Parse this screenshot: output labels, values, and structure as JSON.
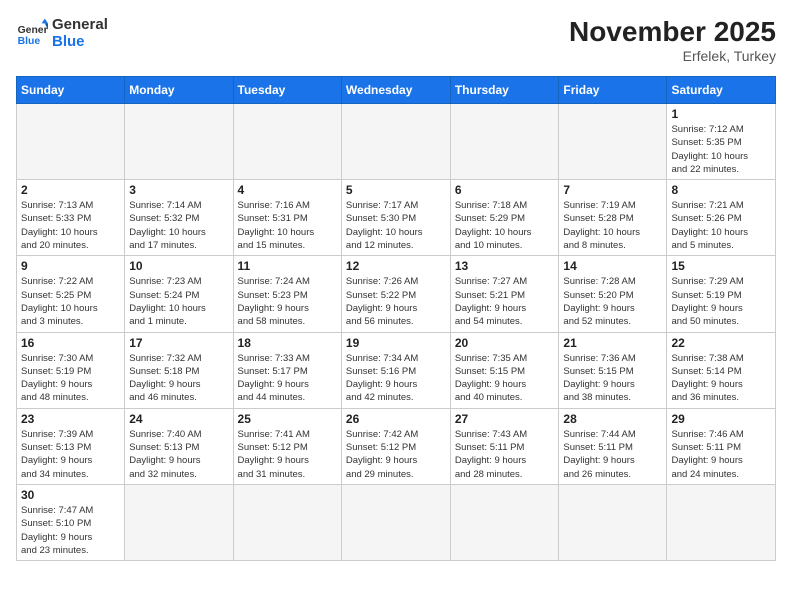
{
  "header": {
    "logo_general": "General",
    "logo_blue": "Blue",
    "month": "November 2025",
    "location": "Erfelek, Turkey"
  },
  "days_of_week": [
    "Sunday",
    "Monday",
    "Tuesday",
    "Wednesday",
    "Thursday",
    "Friday",
    "Saturday"
  ],
  "weeks": [
    [
      {
        "day": "",
        "content": ""
      },
      {
        "day": "",
        "content": ""
      },
      {
        "day": "",
        "content": ""
      },
      {
        "day": "",
        "content": ""
      },
      {
        "day": "",
        "content": ""
      },
      {
        "day": "",
        "content": ""
      },
      {
        "day": "1",
        "content": "Sunrise: 7:12 AM\nSunset: 5:35 PM\nDaylight: 10 hours\nand 22 minutes."
      }
    ],
    [
      {
        "day": "2",
        "content": "Sunrise: 7:13 AM\nSunset: 5:33 PM\nDaylight: 10 hours\nand 20 minutes."
      },
      {
        "day": "3",
        "content": "Sunrise: 7:14 AM\nSunset: 5:32 PM\nDaylight: 10 hours\nand 17 minutes."
      },
      {
        "day": "4",
        "content": "Sunrise: 7:16 AM\nSunset: 5:31 PM\nDaylight: 10 hours\nand 15 minutes."
      },
      {
        "day": "5",
        "content": "Sunrise: 7:17 AM\nSunset: 5:30 PM\nDaylight: 10 hours\nand 12 minutes."
      },
      {
        "day": "6",
        "content": "Sunrise: 7:18 AM\nSunset: 5:29 PM\nDaylight: 10 hours\nand 10 minutes."
      },
      {
        "day": "7",
        "content": "Sunrise: 7:19 AM\nSunset: 5:28 PM\nDaylight: 10 hours\nand 8 minutes."
      },
      {
        "day": "8",
        "content": "Sunrise: 7:21 AM\nSunset: 5:26 PM\nDaylight: 10 hours\nand 5 minutes."
      }
    ],
    [
      {
        "day": "9",
        "content": "Sunrise: 7:22 AM\nSunset: 5:25 PM\nDaylight: 10 hours\nand 3 minutes."
      },
      {
        "day": "10",
        "content": "Sunrise: 7:23 AM\nSunset: 5:24 PM\nDaylight: 10 hours\nand 1 minute."
      },
      {
        "day": "11",
        "content": "Sunrise: 7:24 AM\nSunset: 5:23 PM\nDaylight: 9 hours\nand 58 minutes."
      },
      {
        "day": "12",
        "content": "Sunrise: 7:26 AM\nSunset: 5:22 PM\nDaylight: 9 hours\nand 56 minutes."
      },
      {
        "day": "13",
        "content": "Sunrise: 7:27 AM\nSunset: 5:21 PM\nDaylight: 9 hours\nand 54 minutes."
      },
      {
        "day": "14",
        "content": "Sunrise: 7:28 AM\nSunset: 5:20 PM\nDaylight: 9 hours\nand 52 minutes."
      },
      {
        "day": "15",
        "content": "Sunrise: 7:29 AM\nSunset: 5:19 PM\nDaylight: 9 hours\nand 50 minutes."
      }
    ],
    [
      {
        "day": "16",
        "content": "Sunrise: 7:30 AM\nSunset: 5:19 PM\nDaylight: 9 hours\nand 48 minutes."
      },
      {
        "day": "17",
        "content": "Sunrise: 7:32 AM\nSunset: 5:18 PM\nDaylight: 9 hours\nand 46 minutes."
      },
      {
        "day": "18",
        "content": "Sunrise: 7:33 AM\nSunset: 5:17 PM\nDaylight: 9 hours\nand 44 minutes."
      },
      {
        "day": "19",
        "content": "Sunrise: 7:34 AM\nSunset: 5:16 PM\nDaylight: 9 hours\nand 42 minutes."
      },
      {
        "day": "20",
        "content": "Sunrise: 7:35 AM\nSunset: 5:15 PM\nDaylight: 9 hours\nand 40 minutes."
      },
      {
        "day": "21",
        "content": "Sunrise: 7:36 AM\nSunset: 5:15 PM\nDaylight: 9 hours\nand 38 minutes."
      },
      {
        "day": "22",
        "content": "Sunrise: 7:38 AM\nSunset: 5:14 PM\nDaylight: 9 hours\nand 36 minutes."
      }
    ],
    [
      {
        "day": "23",
        "content": "Sunrise: 7:39 AM\nSunset: 5:13 PM\nDaylight: 9 hours\nand 34 minutes."
      },
      {
        "day": "24",
        "content": "Sunrise: 7:40 AM\nSunset: 5:13 PM\nDaylight: 9 hours\nand 32 minutes."
      },
      {
        "day": "25",
        "content": "Sunrise: 7:41 AM\nSunset: 5:12 PM\nDaylight: 9 hours\nand 31 minutes."
      },
      {
        "day": "26",
        "content": "Sunrise: 7:42 AM\nSunset: 5:12 PM\nDaylight: 9 hours\nand 29 minutes."
      },
      {
        "day": "27",
        "content": "Sunrise: 7:43 AM\nSunset: 5:11 PM\nDaylight: 9 hours\nand 28 minutes."
      },
      {
        "day": "28",
        "content": "Sunrise: 7:44 AM\nSunset: 5:11 PM\nDaylight: 9 hours\nand 26 minutes."
      },
      {
        "day": "29",
        "content": "Sunrise: 7:46 AM\nSunset: 5:11 PM\nDaylight: 9 hours\nand 24 minutes."
      }
    ],
    [
      {
        "day": "30",
        "content": "Sunrise: 7:47 AM\nSunset: 5:10 PM\nDaylight: 9 hours\nand 23 minutes."
      },
      {
        "day": "",
        "content": ""
      },
      {
        "day": "",
        "content": ""
      },
      {
        "day": "",
        "content": ""
      },
      {
        "day": "",
        "content": ""
      },
      {
        "day": "",
        "content": ""
      },
      {
        "day": "",
        "content": ""
      }
    ]
  ]
}
